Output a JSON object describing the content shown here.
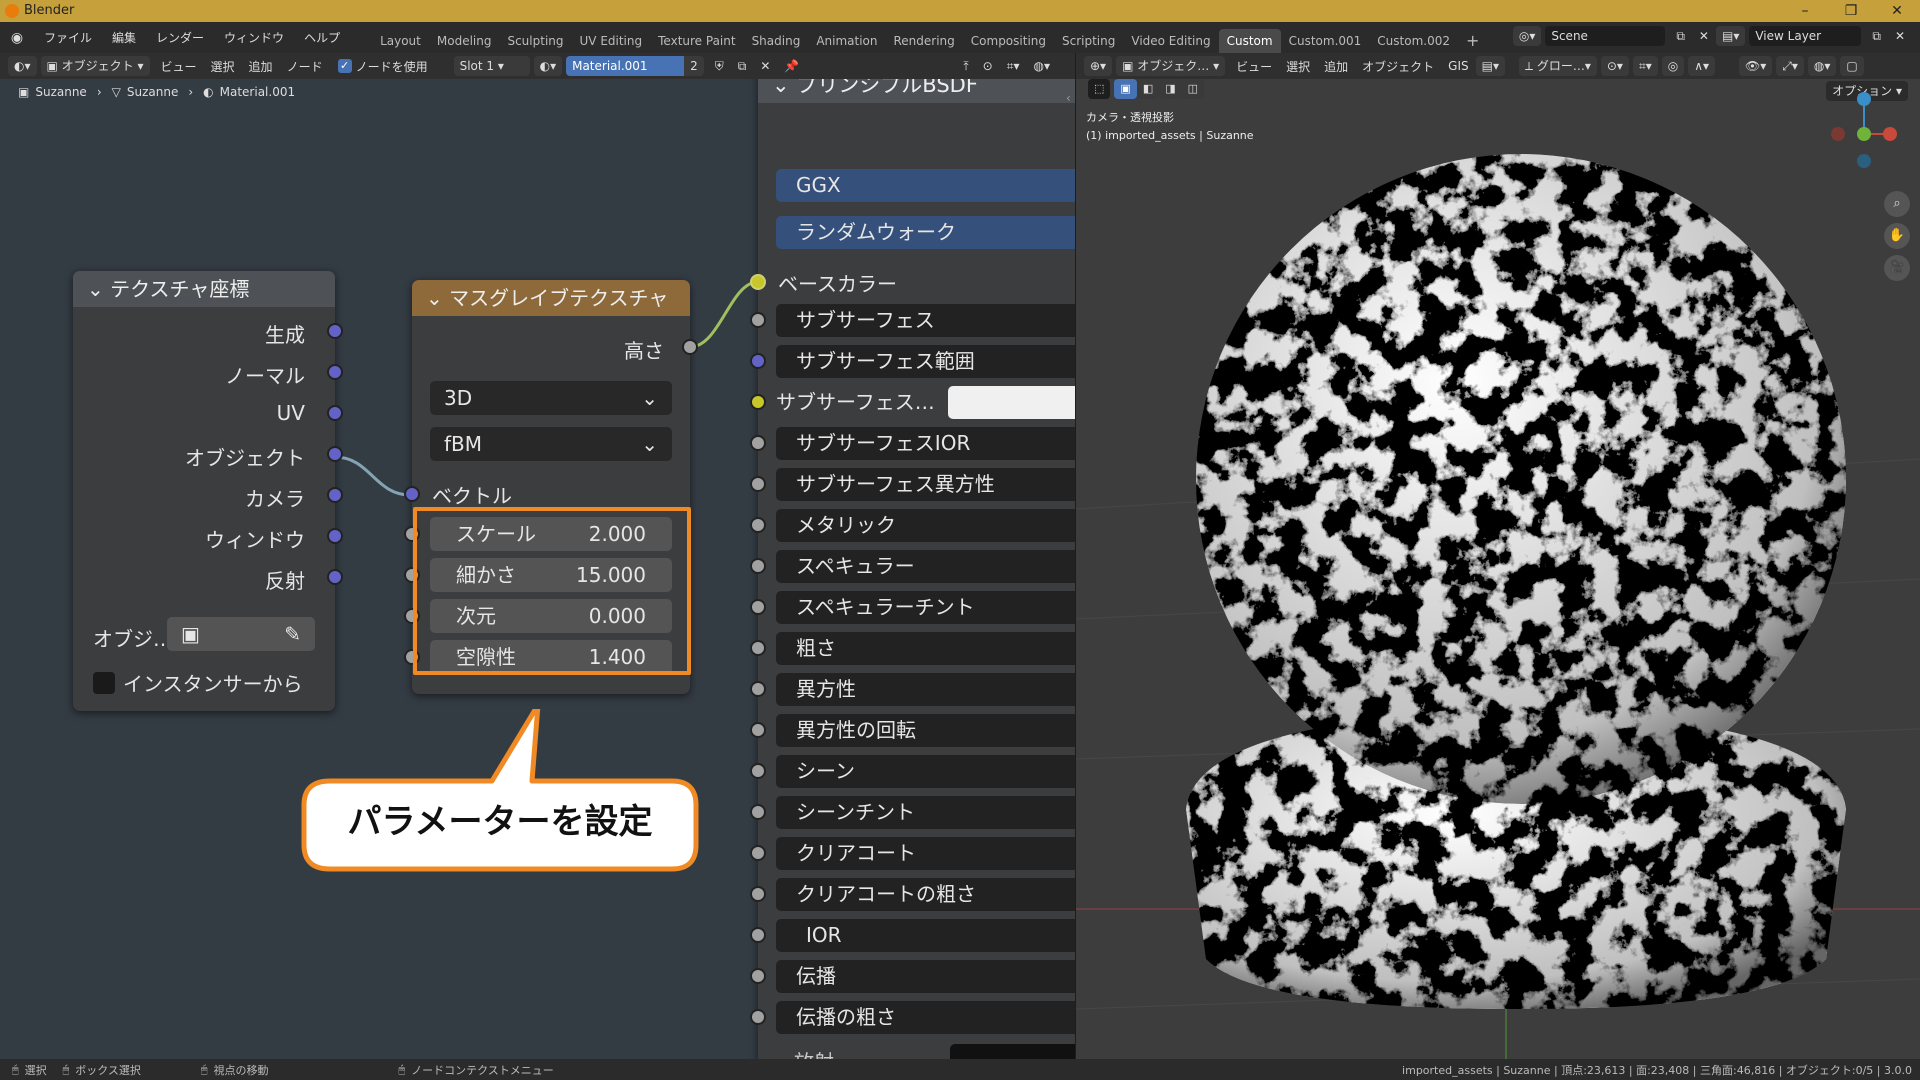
{
  "titlebar": {
    "title": "Blender"
  },
  "menu": {
    "items": [
      "ファイル",
      "編集",
      "レンダー",
      "ウィンドウ",
      "ヘルプ"
    ]
  },
  "workspaces": [
    "Layout",
    "Modeling",
    "Sculpting",
    "UV Editing",
    "Texture Paint",
    "Shading",
    "Animation",
    "Rendering",
    "Compositing",
    "Scripting",
    "Video Editing",
    "Custom",
    "Custom.001",
    "Custom.002"
  ],
  "active_workspace": "Custom",
  "scene": {
    "scene_name": "Scene",
    "view_layer": "View Layer"
  },
  "node_header": {
    "mode": "オブジェクト",
    "items": [
      "ビュー",
      "選択",
      "追加",
      "ノード"
    ],
    "use_nodes_label": "ノードを使用",
    "slot": "Slot 1",
    "material": "Material.001",
    "users": "2"
  },
  "breadcrumb": [
    "Suzanne",
    "Suzanne",
    "Material.001"
  ],
  "viewport_header": {
    "mode": "オブジェク…",
    "items": [
      "ビュー",
      "選択",
      "追加",
      "オブジェクト",
      "GIS"
    ],
    "transform": "グロー…",
    "options": "オプション"
  },
  "viewport": {
    "overlay_line1": "カメラ・透視投影",
    "overlay_line2": "(1) imported_assets | Suzanne"
  },
  "texcoord_node": {
    "title": "テクスチャ座標",
    "outputs": [
      "生成",
      "ノーマル",
      "UV",
      "オブジェクト",
      "カメラ",
      "ウィンドウ",
      "反射"
    ],
    "object_label": "オブジ…",
    "from_instancer": "インスタンサーから"
  },
  "musgrave_node": {
    "title": "マスグレイブテクスチャ",
    "output": "高さ",
    "dimension": "3D",
    "type": "fBM",
    "vector_label": "ベクトル",
    "params": [
      {
        "label": "スケール",
        "value": "2.000"
      },
      {
        "label": "細かさ",
        "value": "15.000"
      },
      {
        "label": "次元",
        "value": "0.000"
      },
      {
        "label": "空隙性",
        "value": "1.400"
      }
    ]
  },
  "callout": {
    "text": "パラメーターを設定"
  },
  "bsdf_node": {
    "title": "プリンシプルBSDF",
    "distribution": "GGX",
    "subsurface_method": "ランダムウォーク",
    "base_color": "ベースカラー",
    "inputs": [
      {
        "label": "サブサーフェス",
        "fill": 0,
        "sock": "gray"
      },
      {
        "label": "サブサーフェス範囲",
        "fill": 1,
        "sock": "blue"
      },
      {
        "label": "サブサーフェス…",
        "fill": 0,
        "sock": "yellow",
        "color": true
      },
      {
        "label": "サブサーフェスIOR",
        "fill": 0.18,
        "sock": "gray"
      },
      {
        "label": "サブサーフェス異方性",
        "fill": 0,
        "sock": "gray"
      },
      {
        "label": "メタリック",
        "fill": 0,
        "sock": "gray"
      },
      {
        "label": "スペキュラー",
        "fill": 0.5,
        "sock": "gray"
      },
      {
        "label": "スペキュラーチント",
        "fill": 0,
        "sock": "gray"
      },
      {
        "label": "粗さ",
        "fill": 0.5,
        "sock": "gray"
      },
      {
        "label": "異方性",
        "fill": 0,
        "sock": "gray"
      },
      {
        "label": "異方性の回転",
        "fill": 0,
        "sock": "gray"
      },
      {
        "label": "シーン",
        "fill": 0,
        "sock": "gray"
      },
      {
        "label": "シーンチント",
        "fill": 0.5,
        "sock": "gray"
      },
      {
        "label": "クリアコート",
        "fill": 0,
        "sock": "gray"
      },
      {
        "label": "クリアコートの粗さ",
        "fill": 0.03,
        "sock": "gray"
      },
      {
        "label": "IOR",
        "fill": 1,
        "sock": "gray"
      },
      {
        "label": "伝播",
        "fill": 0,
        "sock": "gray"
      },
      {
        "label": "伝播の粗さ",
        "fill": 0,
        "sock": "gray"
      }
    ],
    "cut_label": "放射"
  },
  "statusbar": {
    "select": "選択",
    "box_select": "ボックス選択",
    "pan": "視点の移動",
    "context_menu": "ノードコンテクストメニュー",
    "stats": "imported_assets | Suzanne | 頂点:23,613 | 面:23,408 | 三角面:46,816 | オブジェクト:0/5 | 3.0.0"
  },
  "colors": {
    "accent": "#4772b3",
    "highlight": "#f08a24",
    "title_bar": "#c6a13b",
    "node_header_tan": "#8e6a3b"
  }
}
